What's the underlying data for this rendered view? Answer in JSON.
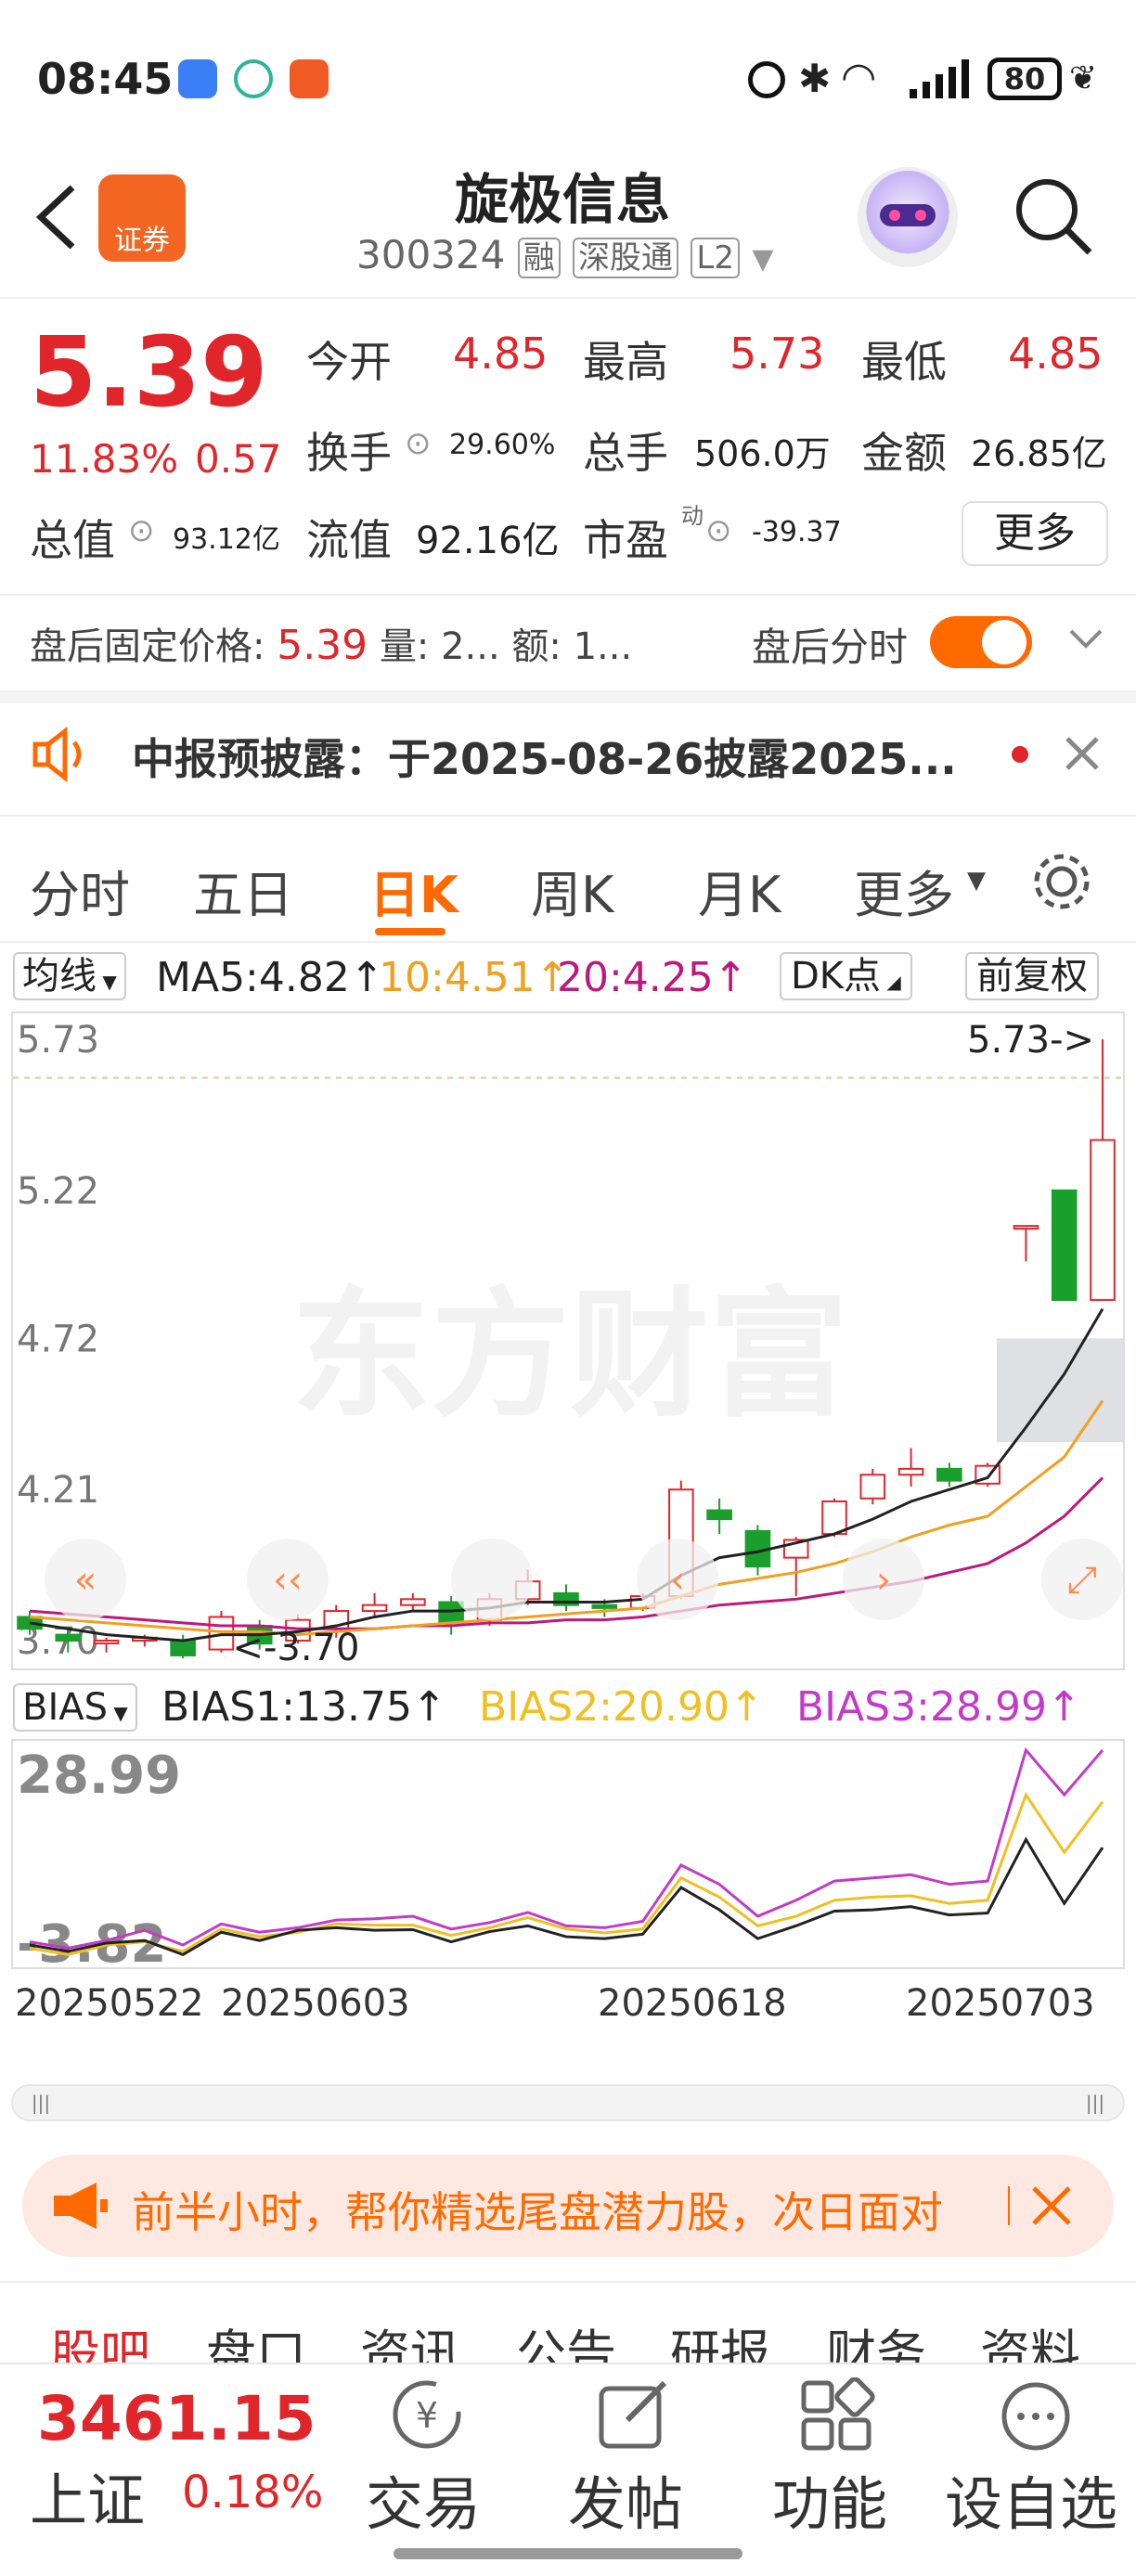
{
  "status_bar": {
    "time": "08:45",
    "battery": "80"
  },
  "header": {
    "title": "旋极信息",
    "code": "300324",
    "badge_rong": "融",
    "badge_market": "深股通",
    "badge_level": "L2",
    "app_logo": "证券"
  },
  "quote": {
    "price": "5.39",
    "change_pct": "11.83%",
    "change": "0.57",
    "open_label": "今开",
    "open": "4.85",
    "high_label": "最高",
    "high": "5.73",
    "low_label": "最低",
    "low": "4.85",
    "turnover_label": "换手",
    "turnover": "29.60%",
    "volume_label": "总手",
    "volume": "506.0万",
    "amount_label": "金额",
    "amount": "26.85亿",
    "total_cap_label": "总值",
    "total_cap": "93.12亿",
    "float_cap_label": "流值",
    "float_cap": "92.16亿",
    "pe_label": "市盈",
    "pe_sup": "动",
    "pe": "-39.37",
    "more_button": "更多"
  },
  "after_hours": {
    "label": "盘后固定价格:",
    "price": "5.39",
    "vol_label": "量:",
    "vol": "2...",
    "amt_label": "额:",
    "amt": "1...",
    "toggle_label": "盘后分时"
  },
  "notice": {
    "text": "中报预披露：于2025-08-26披露2025..."
  },
  "tabs": [
    "分时",
    "五日",
    "日K",
    "周K",
    "月K",
    "更多"
  ],
  "active_tab": "日K",
  "ma_bar": {
    "selector": "均线",
    "ma5": "MA5:4.82↑",
    "ma10": "10:4.51↑",
    "ma20": "20:4.25↑",
    "dk": "DK点",
    "adjust": "前复权"
  },
  "bias_bar": {
    "selector": "BIAS",
    "bias1": "BIAS1:13.75↑",
    "bias2": "BIAS2:20.90↑",
    "bias3": "BIAS3:28.99↑"
  },
  "chart_data": {
    "type": "candlestick",
    "y_ticks": [
      "5.73",
      "5.22",
      "4.72",
      "4.21",
      "3.70"
    ],
    "ylim": [
      3.7,
      5.73
    ],
    "max_marker": "5.73->",
    "min_marker": "<-3.70",
    "watermark": "东方财富",
    "x_ticks": [
      "20250522",
      "20250603",
      "20250618",
      "20250703"
    ],
    "candles": [
      {
        "o": 3.78,
        "h": 3.8,
        "l": 3.72,
        "c": 3.74
      },
      {
        "o": 3.72,
        "h": 3.74,
        "l": 3.66,
        "c": 3.7
      },
      {
        "o": 3.7,
        "h": 3.71,
        "l": 3.66,
        "c": 3.7
      },
      {
        "o": 3.7,
        "h": 3.72,
        "l": 3.68,
        "c": 3.71
      },
      {
        "o": 3.7,
        "h": 3.72,
        "l": 3.64,
        "c": 3.65
      },
      {
        "o": 3.67,
        "h": 3.8,
        "l": 3.66,
        "c": 3.78
      },
      {
        "o": 3.75,
        "h": 3.77,
        "l": 3.67,
        "c": 3.69
      },
      {
        "o": 3.7,
        "h": 3.79,
        "l": 3.69,
        "c": 3.77
      },
      {
        "o": 3.74,
        "h": 3.82,
        "l": 3.71,
        "c": 3.8
      },
      {
        "o": 3.8,
        "h": 3.86,
        "l": 3.78,
        "c": 3.82
      },
      {
        "o": 3.82,
        "h": 3.86,
        "l": 3.8,
        "c": 3.84
      },
      {
        "o": 3.83,
        "h": 3.85,
        "l": 3.72,
        "c": 3.76
      },
      {
        "o": 3.77,
        "h": 3.86,
        "l": 3.75,
        "c": 3.84
      },
      {
        "o": 3.84,
        "h": 3.94,
        "l": 3.82,
        "c": 3.9
      },
      {
        "o": 3.86,
        "h": 3.89,
        "l": 3.8,
        "c": 3.82
      },
      {
        "o": 3.82,
        "h": 3.84,
        "l": 3.78,
        "c": 3.81
      },
      {
        "o": 3.81,
        "h": 3.86,
        "l": 3.8,
        "c": 3.85
      },
      {
        "o": 3.85,
        "h": 4.24,
        "l": 3.84,
        "c": 4.21
      },
      {
        "o": 4.14,
        "h": 4.18,
        "l": 4.06,
        "c": 4.11
      },
      {
        "o": 4.07,
        "h": 4.09,
        "l": 3.92,
        "c": 3.95
      },
      {
        "o": 3.98,
        "h": 4.05,
        "l": 3.85,
        "c": 4.04
      },
      {
        "o": 4.06,
        "h": 4.18,
        "l": 4.05,
        "c": 4.17
      },
      {
        "o": 4.18,
        "h": 4.28,
        "l": 4.16,
        "c": 4.26
      },
      {
        "o": 4.26,
        "h": 4.35,
        "l": 4.22,
        "c": 4.28
      },
      {
        "o": 4.28,
        "h": 4.3,
        "l": 4.22,
        "c": 4.24
      },
      {
        "o": 4.23,
        "h": 4.3,
        "l": 4.22,
        "c": 4.29
      },
      {
        "o": 5.1,
        "h": 5.1,
        "l": 4.98,
        "c": 5.1
      },
      {
        "o": 5.22,
        "h": 5.22,
        "l": 4.85,
        "c": 4.85
      },
      {
        "o": 4.85,
        "h": 5.73,
        "l": 4.85,
        "c": 5.39
      }
    ],
    "ma5": [
      3.76,
      3.74,
      3.72,
      3.71,
      3.7,
      3.72,
      3.72,
      3.73,
      3.75,
      3.78,
      3.8,
      3.8,
      3.81,
      3.83,
      3.83,
      3.83,
      3.84,
      3.92,
      3.98,
      4.0,
      4.03,
      4.06,
      4.11,
      4.17,
      4.21,
      4.25,
      4.42,
      4.6,
      4.82
    ],
    "ma10": [
      3.78,
      3.77,
      3.76,
      3.75,
      3.74,
      3.73,
      3.73,
      3.72,
      3.73,
      3.74,
      3.75,
      3.76,
      3.77,
      3.78,
      3.79,
      3.8,
      3.81,
      3.85,
      3.89,
      3.91,
      3.93,
      3.96,
      4.0,
      4.05,
      4.09,
      4.12,
      4.22,
      4.32,
      4.51
    ],
    "ma20": [
      3.8,
      3.79,
      3.78,
      3.77,
      3.76,
      3.75,
      3.75,
      3.74,
      3.74,
      3.74,
      3.75,
      3.75,
      3.76,
      3.76,
      3.77,
      3.77,
      3.78,
      3.8,
      3.82,
      3.83,
      3.84,
      3.86,
      3.88,
      3.9,
      3.93,
      3.96,
      4.03,
      4.12,
      4.25
    ],
    "bias_ticks": [
      "28.99",
      "-3.82"
    ],
    "bias_ylim": [
      -3.82,
      28.99
    ],
    "bias1": [
      -1.5,
      -2.5,
      -1.2,
      -0.8,
      -3.0,
      0.5,
      -0.8,
      0.8,
      1.2,
      0.8,
      0.9,
      -1.0,
      0.6,
      1.5,
      -0.2,
      -0.5,
      0.2,
      7.5,
      4.0,
      -0.5,
      1.5,
      3.8,
      4.0,
      4.5,
      3.2,
      3.5,
      15.0,
      5.0,
      13.75
    ],
    "bias2": [
      -2.0,
      -3.0,
      -1.5,
      -1.0,
      -2.5,
      1.0,
      -0.2,
      0.5,
      1.8,
      1.6,
      1.6,
      0.0,
      1.2,
      2.8,
      1.0,
      0.4,
      1.0,
      9.0,
      6.0,
      1.5,
      3.0,
      5.5,
      6.0,
      6.2,
      5.0,
      5.5,
      22.0,
      13.0,
      20.9
    ],
    "bias3": [
      -1.0,
      -2.0,
      -0.8,
      0.8,
      -1.5,
      1.8,
      0.5,
      1.2,
      2.4,
      2.6,
      3.0,
      1.0,
      2.0,
      3.6,
      1.5,
      1.2,
      2.2,
      11.0,
      8.0,
      3.0,
      5.5,
      8.5,
      9.0,
      9.5,
      8.0,
      8.5,
      28.99,
      22.0,
      28.99
    ]
  },
  "promo": {
    "text": "前半小时，帮你精选尾盘潜力股，次日面对"
  },
  "sub_tabs": [
    "股吧",
    "盘口",
    "资讯",
    "公告",
    "研报",
    "财务",
    "资料"
  ],
  "bottom_bar": {
    "index_value": "3461.15",
    "index_name": "上证",
    "index_change": "0.18%",
    "trade": "交易",
    "post": "发帖",
    "function": "功能",
    "watchlist": "设自选"
  },
  "colors": {
    "up": "#e0262b",
    "down": "#1a9e2c",
    "ma5": "#222222",
    "ma10": "#f0a020",
    "ma20": "#c0187a",
    "accent": "#ff6a00"
  }
}
